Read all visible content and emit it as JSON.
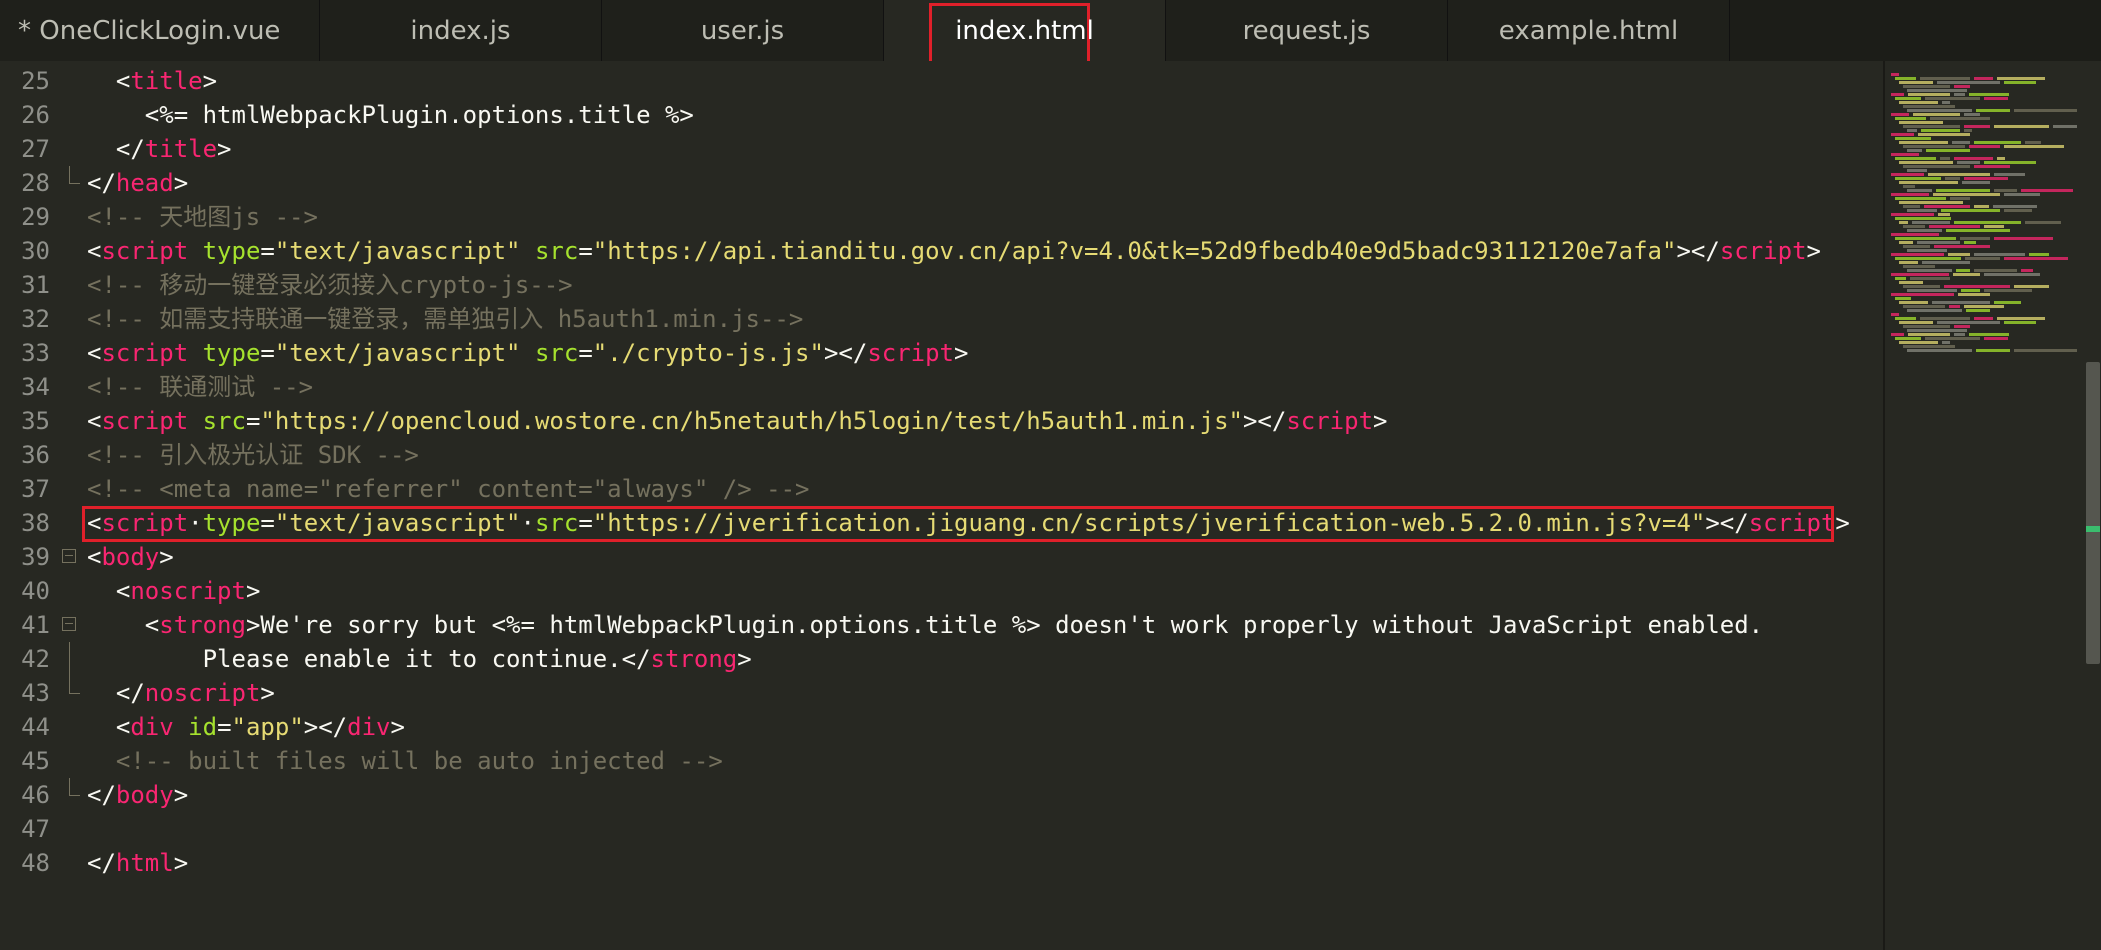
{
  "tabs": [
    {
      "label": "* OneClickLogin.vue",
      "active": false
    },
    {
      "label": "index.js",
      "active": false
    },
    {
      "label": "user.js",
      "active": false
    },
    {
      "label": "index.html",
      "active": true
    },
    {
      "label": "request.js",
      "active": false
    },
    {
      "label": "example.html",
      "active": false
    }
  ],
  "lines": [
    {
      "n": "25",
      "tokens": [
        [
          "p",
          "  <"
        ],
        [
          "t",
          "title"
        ],
        [
          "p",
          ">"
        ]
      ]
    },
    {
      "n": "26",
      "tokens": [
        [
          "x",
          "    <%= htmlWebpackPlugin.options.title %>"
        ]
      ]
    },
    {
      "n": "27",
      "tokens": [
        [
          "p",
          "  </"
        ],
        [
          "t",
          "title"
        ],
        [
          "p",
          ">"
        ]
      ]
    },
    {
      "n": "28",
      "tokens": [
        [
          "p",
          "</"
        ],
        [
          "t",
          "head"
        ],
        [
          "p",
          ">"
        ]
      ]
    },
    {
      "n": "29",
      "tokens": [
        [
          "c",
          "<!-- 天地图js -->"
        ]
      ]
    },
    {
      "n": "30",
      "tokens": [
        [
          "p",
          "<"
        ],
        [
          "t",
          "script"
        ],
        [
          "p",
          " "
        ],
        [
          "a",
          "type"
        ],
        [
          "p",
          "="
        ],
        [
          "s",
          "\"text/javascript\""
        ],
        [
          "p",
          " "
        ],
        [
          "a",
          "src"
        ],
        [
          "p",
          "="
        ],
        [
          "s",
          "\"https://api.tianditu.gov.cn/api?v=4.0&tk=52d9fbedb40e9d5badc93112120e7afa\""
        ],
        [
          "p",
          "></"
        ],
        [
          "t",
          "script"
        ],
        [
          "p",
          ">"
        ]
      ]
    },
    {
      "n": "31",
      "tokens": [
        [
          "c",
          "<!-- 移动一键登录必须接入crypto-js-->"
        ]
      ]
    },
    {
      "n": "32",
      "tokens": [
        [
          "c",
          "<!-- 如需支持联通一键登录，需单独引入 h5auth1.min.js-->"
        ]
      ]
    },
    {
      "n": "33",
      "tokens": [
        [
          "p",
          "<"
        ],
        [
          "t",
          "script"
        ],
        [
          "p",
          " "
        ],
        [
          "a",
          "type"
        ],
        [
          "p",
          "="
        ],
        [
          "s",
          "\"text/javascript\""
        ],
        [
          "p",
          " "
        ],
        [
          "a",
          "src"
        ],
        [
          "p",
          "="
        ],
        [
          "s",
          "\"./crypto-js.js\""
        ],
        [
          "p",
          "></"
        ],
        [
          "t",
          "script"
        ],
        [
          "p",
          ">"
        ]
      ]
    },
    {
      "n": "34",
      "tokens": [
        [
          "c",
          "<!-- 联通测试 -->"
        ]
      ]
    },
    {
      "n": "35",
      "tokens": [
        [
          "p",
          "<"
        ],
        [
          "t",
          "script"
        ],
        [
          "p",
          " "
        ],
        [
          "a",
          "src"
        ],
        [
          "p",
          "="
        ],
        [
          "s",
          "\"https://opencloud.wostore.cn/h5netauth/h5login/test/h5auth1.min.js\""
        ],
        [
          "p",
          "></"
        ],
        [
          "t",
          "script"
        ],
        [
          "p",
          ">"
        ]
      ]
    },
    {
      "n": "36",
      "tokens": [
        [
          "c",
          "<!-- 引入极光认证 SDK -->"
        ]
      ]
    },
    {
      "n": "37",
      "tokens": [
        [
          "c",
          "<!-- <meta name=\"referrer\" content=\"always\" /> -->"
        ]
      ]
    },
    {
      "n": "38",
      "tokens": [
        [
          "p",
          "<"
        ],
        [
          "t",
          "script"
        ],
        [
          "p",
          "·"
        ],
        [
          "a",
          "type"
        ],
        [
          "p",
          "="
        ],
        [
          "s",
          "\"text/javascript\""
        ],
        [
          "p",
          "·"
        ],
        [
          "a",
          "src"
        ],
        [
          "p",
          "="
        ],
        [
          "s",
          "\"https://jverification.jiguang.cn/scripts/jverification-web.5.2.0.min.js?v=4\""
        ],
        [
          "p",
          "></"
        ],
        [
          "t",
          "script"
        ],
        [
          "p",
          ">"
        ]
      ]
    },
    {
      "n": "39",
      "tokens": [
        [
          "p",
          "<"
        ],
        [
          "t",
          "body"
        ],
        [
          "p",
          ">"
        ]
      ]
    },
    {
      "n": "40",
      "tokens": [
        [
          "p",
          "  <"
        ],
        [
          "t",
          "noscript"
        ],
        [
          "p",
          ">"
        ]
      ]
    },
    {
      "n": "41",
      "tokens": [
        [
          "p",
          "    <"
        ],
        [
          "t",
          "strong"
        ],
        [
          "x",
          ">We're sorry but <%= htmlWebpackPlugin.options.title %> doesn't work properly without JavaScript enabled."
        ]
      ]
    },
    {
      "n": "42",
      "tokens": [
        [
          "x",
          "        Please enable it to continue.</"
        ],
        [
          "t",
          "strong"
        ],
        [
          "p",
          ">"
        ]
      ]
    },
    {
      "n": "43",
      "tokens": [
        [
          "p",
          "  </"
        ],
        [
          "t",
          "noscript"
        ],
        [
          "p",
          ">"
        ]
      ]
    },
    {
      "n": "44",
      "tokens": [
        [
          "p",
          "  <"
        ],
        [
          "t",
          "div"
        ],
        [
          "p",
          " "
        ],
        [
          "a",
          "id"
        ],
        [
          "p",
          "="
        ],
        [
          "s",
          "\"app\""
        ],
        [
          "p",
          "></"
        ],
        [
          "t",
          "div"
        ],
        [
          "p",
          ">"
        ]
      ]
    },
    {
      "n": "45",
      "tokens": [
        [
          "c",
          "  <!-- built files will be auto injected -->"
        ]
      ]
    },
    {
      "n": "46",
      "tokens": [
        [
          "p",
          "</"
        ],
        [
          "t",
          "body"
        ],
        [
          "p",
          ">"
        ]
      ]
    },
    {
      "n": "47",
      "tokens": []
    },
    {
      "n": "48",
      "tokens": [
        [
          "p",
          "</"
        ],
        [
          "t",
          "html"
        ],
        [
          "p",
          ">"
        ]
      ]
    }
  ],
  "colors": {
    "background": "#272822",
    "tag": "#f92672",
    "attribute": "#a6e22e",
    "string": "#e6db74",
    "comment": "#75715e",
    "highlight": "#e0202a"
  }
}
